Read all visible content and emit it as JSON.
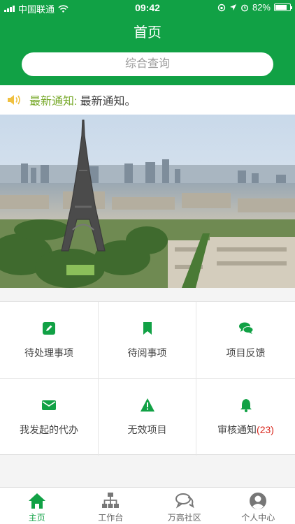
{
  "status_bar": {
    "carrier": "中国联通",
    "time": "09:42",
    "battery": "82%",
    "battery_level": 0.82
  },
  "header": {
    "title": "首页",
    "search_placeholder": "综合查询"
  },
  "notice": {
    "label": "最新通知:",
    "text": "最新通知。"
  },
  "banner": {
    "slide_count": 4,
    "active_slide": 1
  },
  "menu": [
    {
      "label": "待处理事项",
      "icon": "edit-icon"
    },
    {
      "label": "待阅事项",
      "icon": "bookmark-icon"
    },
    {
      "label": "项目反馈",
      "icon": "comments-icon"
    },
    {
      "label": "我发起的代办",
      "icon": "envelope-icon"
    },
    {
      "label": "无效项目",
      "icon": "warning-icon"
    },
    {
      "label": "审核通知",
      "badge": "(23)",
      "icon": "bell-icon"
    }
  ],
  "tabs": [
    {
      "label": "主页",
      "icon": "home-icon",
      "active": true
    },
    {
      "label": "工作台",
      "icon": "sitemap-icon"
    },
    {
      "label": "万高社区",
      "icon": "chat-icon"
    },
    {
      "label": "个人中心",
      "icon": "user-icon"
    }
  ],
  "colors": {
    "brand_green": "#11a145",
    "notice_label": "#76a828",
    "badge_red": "#d9261c"
  }
}
